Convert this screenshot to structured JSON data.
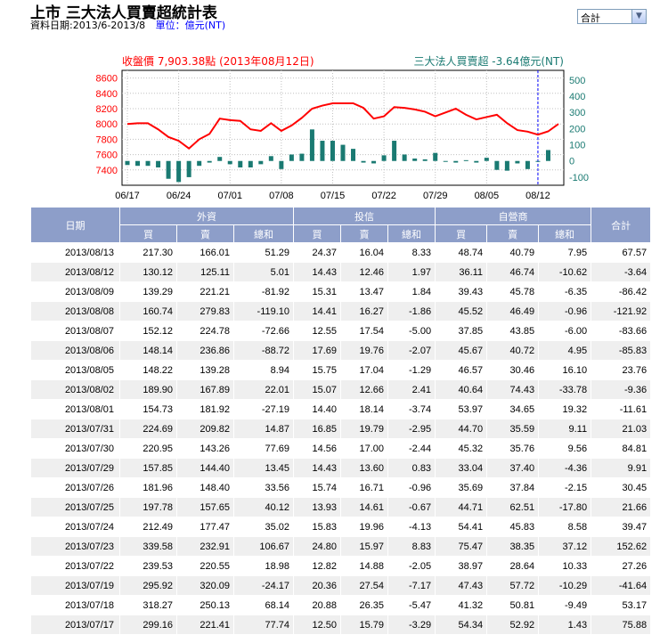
{
  "header": {
    "title": "上市 三大法人買賣超統計表",
    "date_range": "資料日期:2013/6-2013/8",
    "unit": "單位：億元(NT)",
    "select_value": "合計"
  },
  "chart_data": {
    "type": "line+bar",
    "left_label": "收盤價 7,903.38點 (2013年08月12日)",
    "right_label": "三大法人買賣超 -3.64億元(NT)",
    "left_axis": {
      "ylim": [
        7200,
        8700
      ],
      "ticks": [
        8600,
        8400,
        8200,
        8000,
        7800,
        7600,
        7400
      ]
    },
    "right_axis": {
      "ylim": [
        -150,
        560
      ],
      "ticks": [
        500,
        400,
        300,
        200,
        100,
        0,
        -100
      ]
    },
    "x_ticks": [
      "06/17",
      "06/24",
      "07/01",
      "07/08",
      "07/15",
      "07/22",
      "07/29",
      "08/05",
      "08/12"
    ],
    "x_tick_index": [
      0,
      5,
      10,
      15,
      20,
      25,
      30,
      35,
      40
    ],
    "series": [
      {
        "name": "收盤價",
        "kind": "line",
        "color": "#ff0000",
        "values": [
          8000,
          8010,
          8010,
          7930,
          7830,
          7780,
          7680,
          7800,
          7870,
          8070,
          8050,
          8040,
          7930,
          7910,
          8010,
          7910,
          7980,
          8080,
          8200,
          8240,
          8270,
          8270,
          8270,
          8210,
          8070,
          8100,
          8220,
          8210,
          8190,
          8160,
          8100,
          8150,
          8200,
          8120,
          8060,
          8090,
          8120,
          8010,
          7920,
          7900,
          7860,
          7903.38,
          8000
        ]
      },
      {
        "name": "三大法人買賣超",
        "kind": "bar",
        "color": "#1a7a72",
        "values": [
          -25,
          -30,
          -30,
          -40,
          -110,
          -130,
          -100,
          -30,
          -10,
          25,
          -20,
          -40,
          -40,
          -20,
          30,
          -50,
          40,
          45,
          195,
          125,
          125,
          100,
          75,
          -10,
          -15,
          35,
          125,
          40,
          15,
          10,
          50,
          0,
          -10,
          5,
          -10,
          20,
          -55,
          -60,
          -15,
          -50,
          -3.64,
          67.57
        ]
      }
    ],
    "grid": true,
    "dashed_vertical_marker": "08/12"
  },
  "table": {
    "headers_top": [
      "日期",
      "外資",
      "投信",
      "自營商",
      "合計"
    ],
    "headers_sub": [
      "買",
      "賣",
      "總和",
      "買",
      "賣",
      "總和",
      "買",
      "賣",
      "總和"
    ],
    "rows": [
      [
        "2013/08/13",
        "217.30",
        "166.01",
        "51.29",
        "24.37",
        "16.04",
        "8.33",
        "48.74",
        "40.79",
        "7.95",
        "67.57"
      ],
      [
        "2013/08/12",
        "130.12",
        "125.11",
        "5.01",
        "14.43",
        "12.46",
        "1.97",
        "36.11",
        "46.74",
        "-10.62",
        "-3.64"
      ],
      [
        "2013/08/09",
        "139.29",
        "221.21",
        "-81.92",
        "15.31",
        "13.47",
        "1.84",
        "39.43",
        "45.78",
        "-6.35",
        "-86.42"
      ],
      [
        "2013/08/08",
        "160.74",
        "279.83",
        "-119.10",
        "14.41",
        "16.27",
        "-1.86",
        "45.52",
        "46.49",
        "-0.96",
        "-121.92"
      ],
      [
        "2013/08/07",
        "152.12",
        "224.78",
        "-72.66",
        "12.55",
        "17.54",
        "-5.00",
        "37.85",
        "43.85",
        "-6.00",
        "-83.66"
      ],
      [
        "2013/08/06",
        "148.14",
        "236.86",
        "-88.72",
        "17.69",
        "19.76",
        "-2.07",
        "45.67",
        "40.72",
        "4.95",
        "-85.83"
      ],
      [
        "2013/08/05",
        "148.22",
        "139.28",
        "8.94",
        "15.75",
        "17.04",
        "-1.29",
        "46.57",
        "30.46",
        "16.10",
        "23.76"
      ],
      [
        "2013/08/02",
        "189.90",
        "167.89",
        "22.01",
        "15.07",
        "12.66",
        "2.41",
        "40.64",
        "74.43",
        "-33.78",
        "-9.36"
      ],
      [
        "2013/08/01",
        "154.73",
        "181.92",
        "-27.19",
        "14.40",
        "18.14",
        "-3.74",
        "53.97",
        "34.65",
        "19.32",
        "-11.61"
      ],
      [
        "2013/07/31",
        "224.69",
        "209.82",
        "14.87",
        "16.85",
        "19.79",
        "-2.95",
        "44.70",
        "35.59",
        "9.11",
        "21.03"
      ],
      [
        "2013/07/30",
        "220.95",
        "143.26",
        "77.69",
        "14.56",
        "17.00",
        "-2.44",
        "45.32",
        "35.76",
        "9.56",
        "84.81"
      ],
      [
        "2013/07/29",
        "157.85",
        "144.40",
        "13.45",
        "14.43",
        "13.60",
        "0.83",
        "33.04",
        "37.40",
        "-4.36",
        "9.91"
      ],
      [
        "2013/07/26",
        "181.96",
        "148.40",
        "33.56",
        "15.74",
        "16.71",
        "-0.96",
        "35.69",
        "37.84",
        "-2.15",
        "30.45"
      ],
      [
        "2013/07/25",
        "197.78",
        "157.65",
        "40.12",
        "13.93",
        "14.61",
        "-0.67",
        "44.71",
        "62.51",
        "-17.80",
        "21.66"
      ],
      [
        "2013/07/24",
        "212.49",
        "177.47",
        "35.02",
        "15.83",
        "19.96",
        "-4.13",
        "54.41",
        "45.83",
        "8.58",
        "39.47"
      ],
      [
        "2013/07/23",
        "339.58",
        "232.91",
        "106.67",
        "24.80",
        "15.97",
        "8.83",
        "75.47",
        "38.35",
        "37.12",
        "152.62"
      ],
      [
        "2013/07/22",
        "239.53",
        "220.55",
        "18.98",
        "12.82",
        "14.88",
        "-2.05",
        "38.97",
        "28.64",
        "10.33",
        "27.26"
      ],
      [
        "2013/07/19",
        "295.92",
        "320.09",
        "-24.17",
        "20.36",
        "27.54",
        "-7.17",
        "47.43",
        "57.72",
        "-10.29",
        "-41.64"
      ],
      [
        "2013/07/18",
        "318.27",
        "250.13",
        "68.14",
        "20.88",
        "26.35",
        "-5.47",
        "41.32",
        "50.81",
        "-9.49",
        "53.17"
      ],
      [
        "2013/07/17",
        "299.16",
        "221.41",
        "77.74",
        "12.50",
        "15.79",
        "-3.29",
        "54.34",
        "52.92",
        "1.43",
        "75.88"
      ]
    ]
  }
}
